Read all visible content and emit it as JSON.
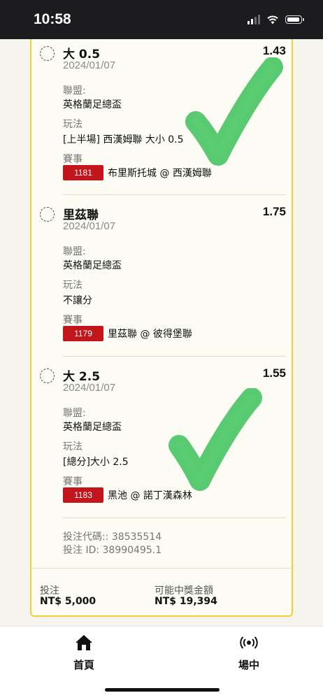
{
  "status_bar": {
    "time": "10:58"
  },
  "bets": [
    {
      "selection": "大 0.5",
      "odds": "1.43",
      "date": "2024/01/07",
      "league_label": "聯盟:",
      "league": "英格蘭足總盃",
      "market_label": "玩法",
      "market": "[上半場] 西漢姆聯 大小 0.5",
      "match_label": "賽事",
      "match_id": "1181",
      "match": "布里斯托城 @ 西漢姆聯"
    },
    {
      "selection": "里茲聯",
      "odds": "1.75",
      "date": "2024/01/07",
      "league_label": "聯盟:",
      "league": "英格蘭足總盃",
      "market_label": "玩法",
      "market": "不讓分",
      "match_label": "賽事",
      "match_id": "1179",
      "match": "里茲聯 @ 彼得堡聯"
    },
    {
      "selection": "大 2.5",
      "odds": "1.55",
      "date": "2024/01/07",
      "league_label": "聯盟:",
      "league": "英格蘭足總盃",
      "market_label": "玩法",
      "market": "[總分]大小 2.5",
      "match_label": "賽事",
      "match_id": "1183",
      "match": "黑池 @ 諾丁漢森林"
    }
  ],
  "bet_info": {
    "code": "投注代碼:: 38535514",
    "id": "投注 ID: 38990495.1"
  },
  "summary": {
    "stake_label": "投注",
    "stake_value": "NT$ 5,000",
    "win_label": "可能中獎金額",
    "win_value": "NT$ 19,394"
  },
  "tabbar": {
    "home_label": "首頁",
    "live_label": "場中"
  },
  "icons": {
    "home": "house-icon",
    "live": "broadcast-icon",
    "selection": "radio-dashed-icon",
    "overlay": "green-checkmark-icon"
  },
  "colors": {
    "card_border": "#f2cf32",
    "match_id_bg": "#c3161c",
    "check_green": "#3cc15a"
  }
}
